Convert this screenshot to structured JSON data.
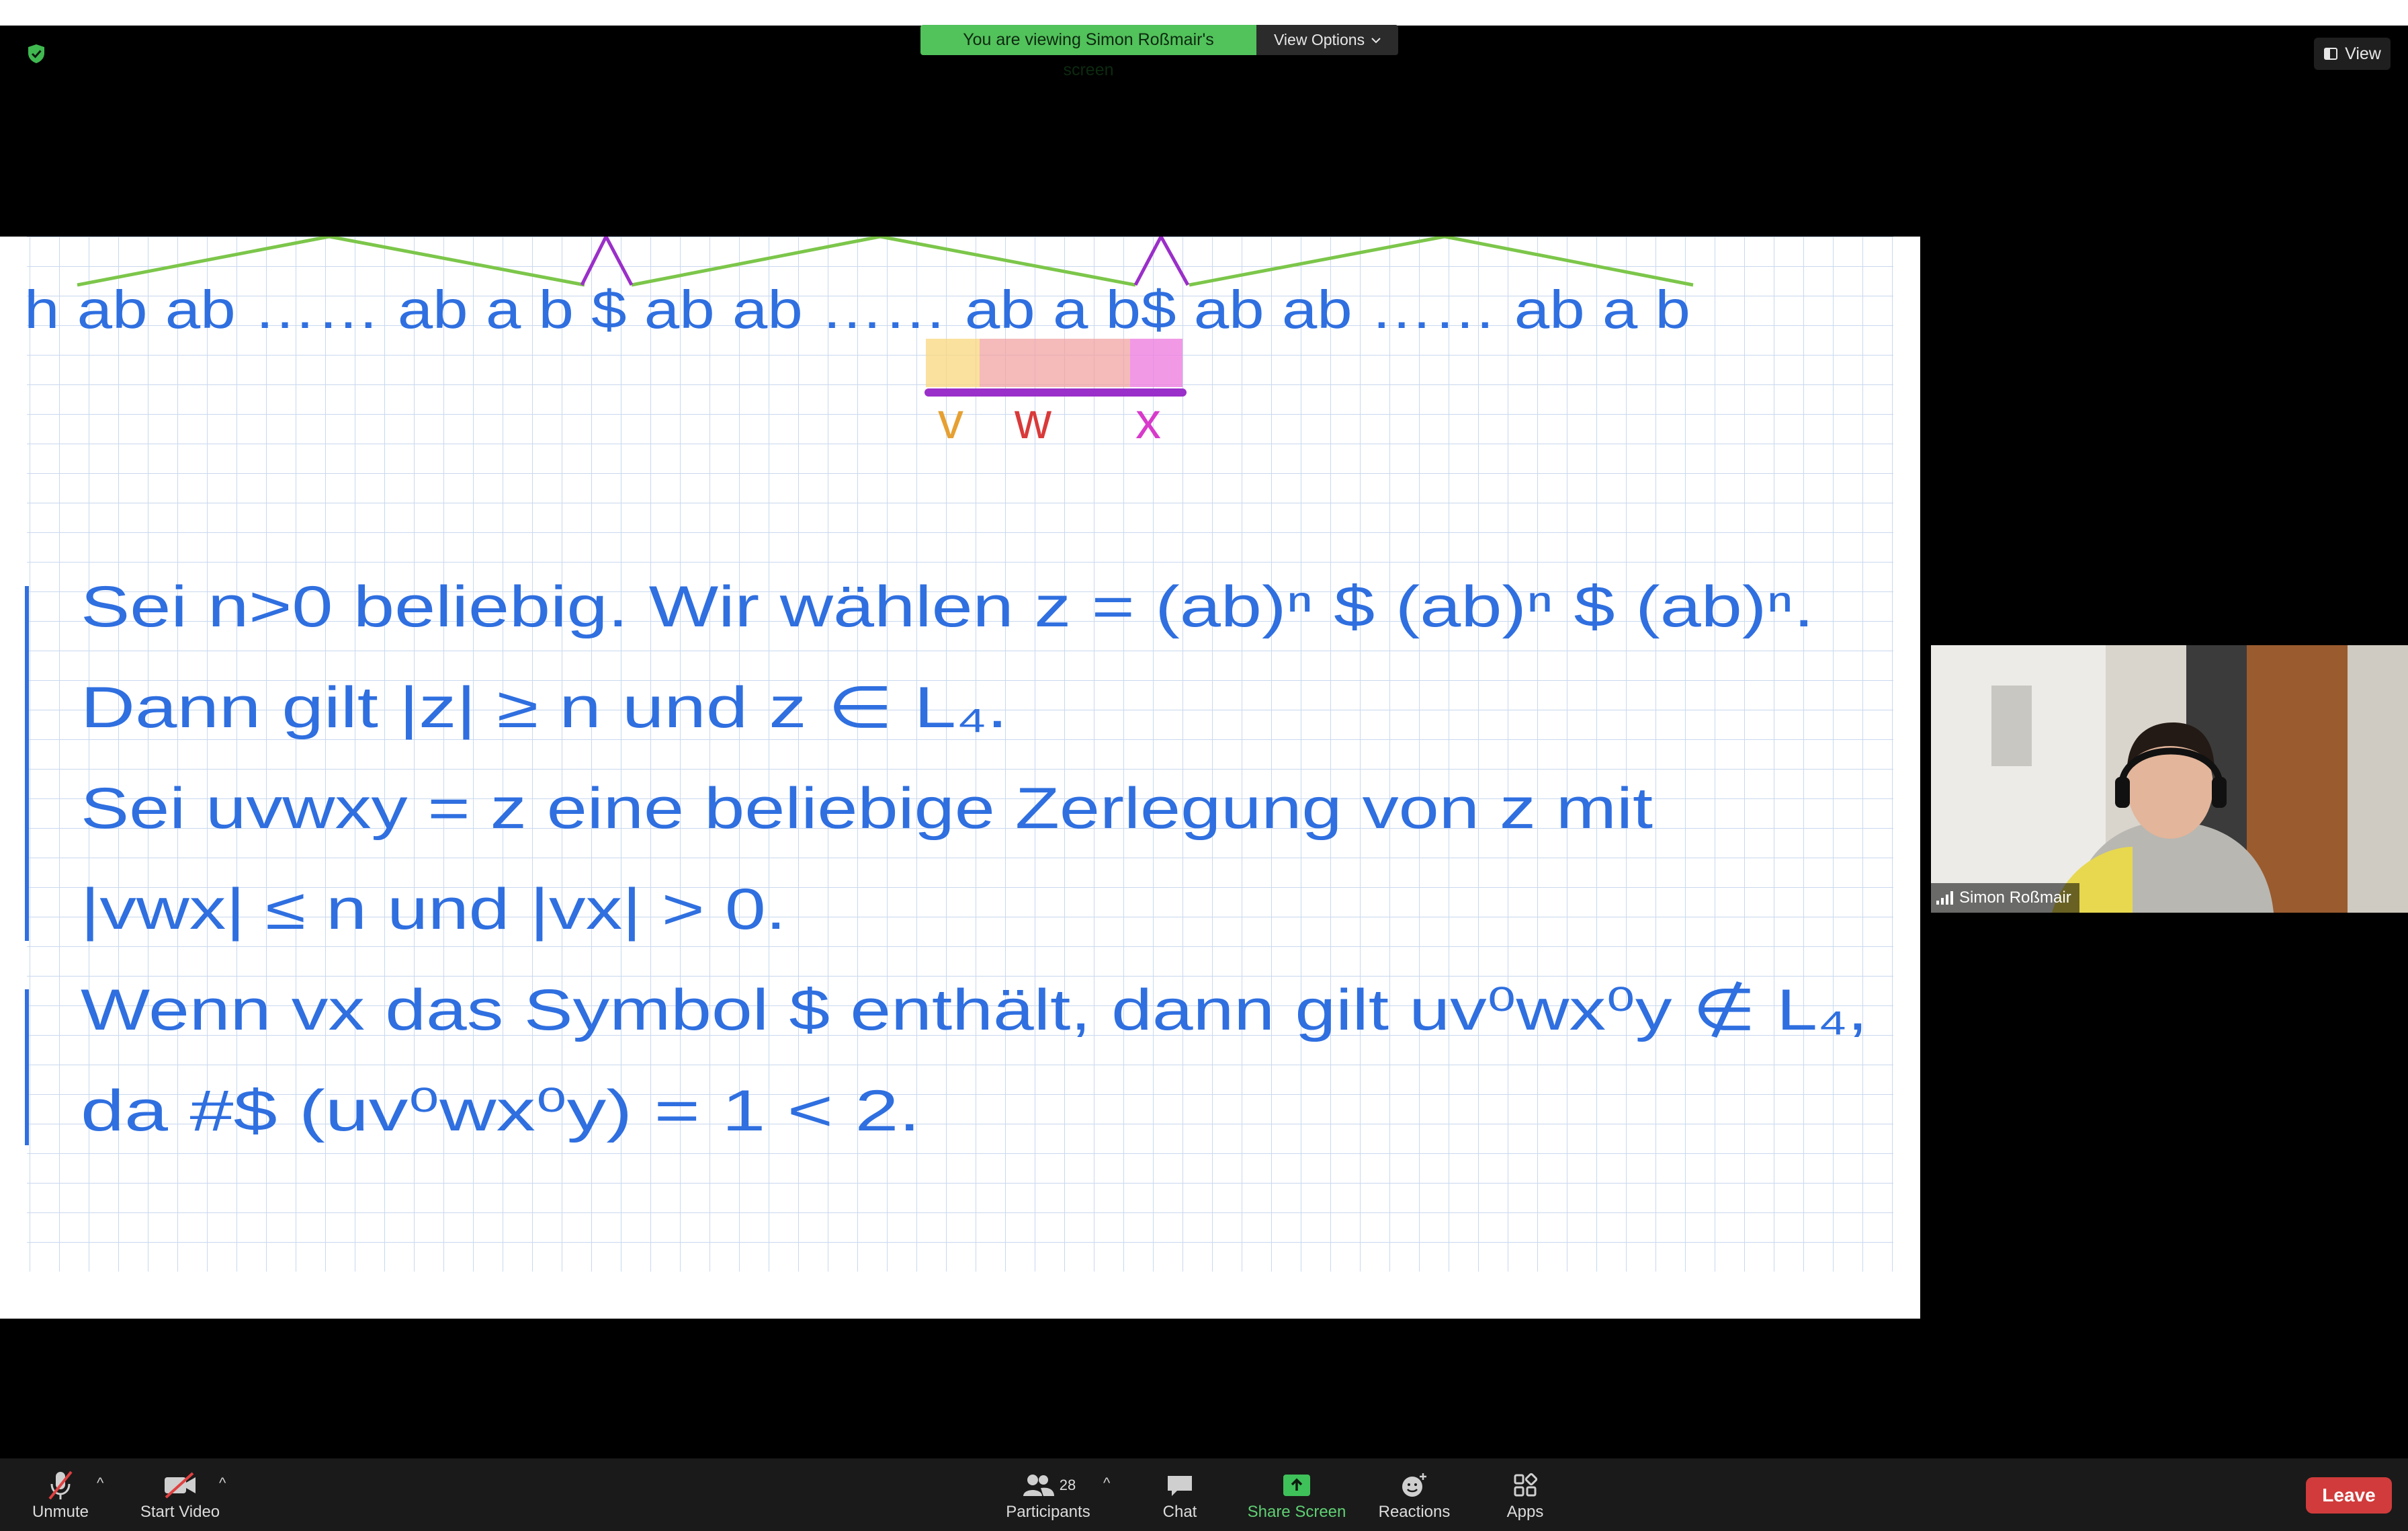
{
  "top_banner": {
    "message": "You are viewing Simon Roßmair's screen",
    "view_options_label": "View Options",
    "view_label": "View"
  },
  "notebook": {
    "string_row": "h ab ab …… ab a b $ ab ab …… ab a b$ ab ab …… ab a b",
    "labels": {
      "v": "v",
      "w": "w",
      "x": "x"
    },
    "lines": [
      "Sei n>0 beliebig. Wir wählen z = (ab)ⁿ $ (ab)ⁿ $ (ab)ⁿ.",
      "Dann gilt |z| ≥ n und z ∈ L₄.",
      "Sei uvwxy = z eine beliebige Zerlegung von z mit",
      "|vwx| ≤ n und |vx| > 0.",
      "Wenn vx das Symbol $ enthält, dann gilt uv⁰wx⁰y ∉ L₄,",
      "da #$ (uv⁰wx⁰y) = 1 < 2."
    ],
    "colors": {
      "ink": "#2f6fe0",
      "grid": "#c9d8ee",
      "v_highlight": "#f9d77e",
      "w_highlight": "#f2a3a3",
      "x_highlight": "#ef7fe0",
      "bracket": "#9a2fc9"
    }
  },
  "participant": {
    "name": "Simon Roßmair"
  },
  "controls": {
    "unmute": "Unmute",
    "start_video": "Start Video",
    "participants": "Participants",
    "participants_count": "28",
    "chat": "Chat",
    "share_screen": "Share Screen",
    "reactions": "Reactions",
    "apps": "Apps",
    "leave": "Leave"
  }
}
